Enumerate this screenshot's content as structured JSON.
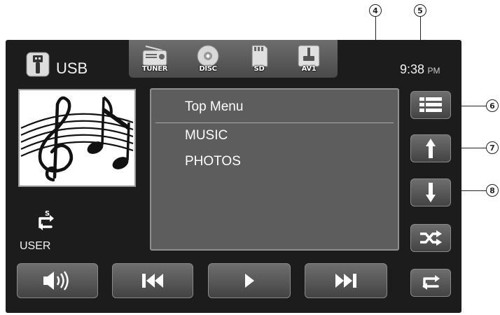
{
  "source": {
    "label": "USB",
    "icon": "usb-icon"
  },
  "clock": {
    "time": "9:38",
    "ampm": "PM"
  },
  "source_buttons": [
    {
      "label": "TUNER",
      "icon": "radio-icon"
    },
    {
      "label": "DISC",
      "icon": "disc-icon"
    },
    {
      "label": "SD",
      "icon": "sd-card-icon"
    },
    {
      "label": "AV1",
      "icon": "av-input-icon"
    }
  ],
  "menu": {
    "title": "Top Menu",
    "items": [
      "MUSIC",
      "PHOTOS"
    ]
  },
  "repeat_mode": {
    "badge": "S",
    "label": "USER"
  },
  "side_buttons": [
    {
      "icon": "list-icon"
    },
    {
      "icon": "up-arrow-icon"
    },
    {
      "icon": "down-arrow-icon"
    },
    {
      "icon": "shuffle-icon"
    },
    {
      "icon": "repeat-icon"
    }
  ],
  "bottom_buttons": [
    {
      "icon": "volume-icon"
    },
    {
      "icon": "previous-track-icon"
    },
    {
      "icon": "play-icon"
    },
    {
      "icon": "next-track-icon"
    }
  ],
  "callouts": [
    "4",
    "5",
    "6",
    "7",
    "8"
  ]
}
